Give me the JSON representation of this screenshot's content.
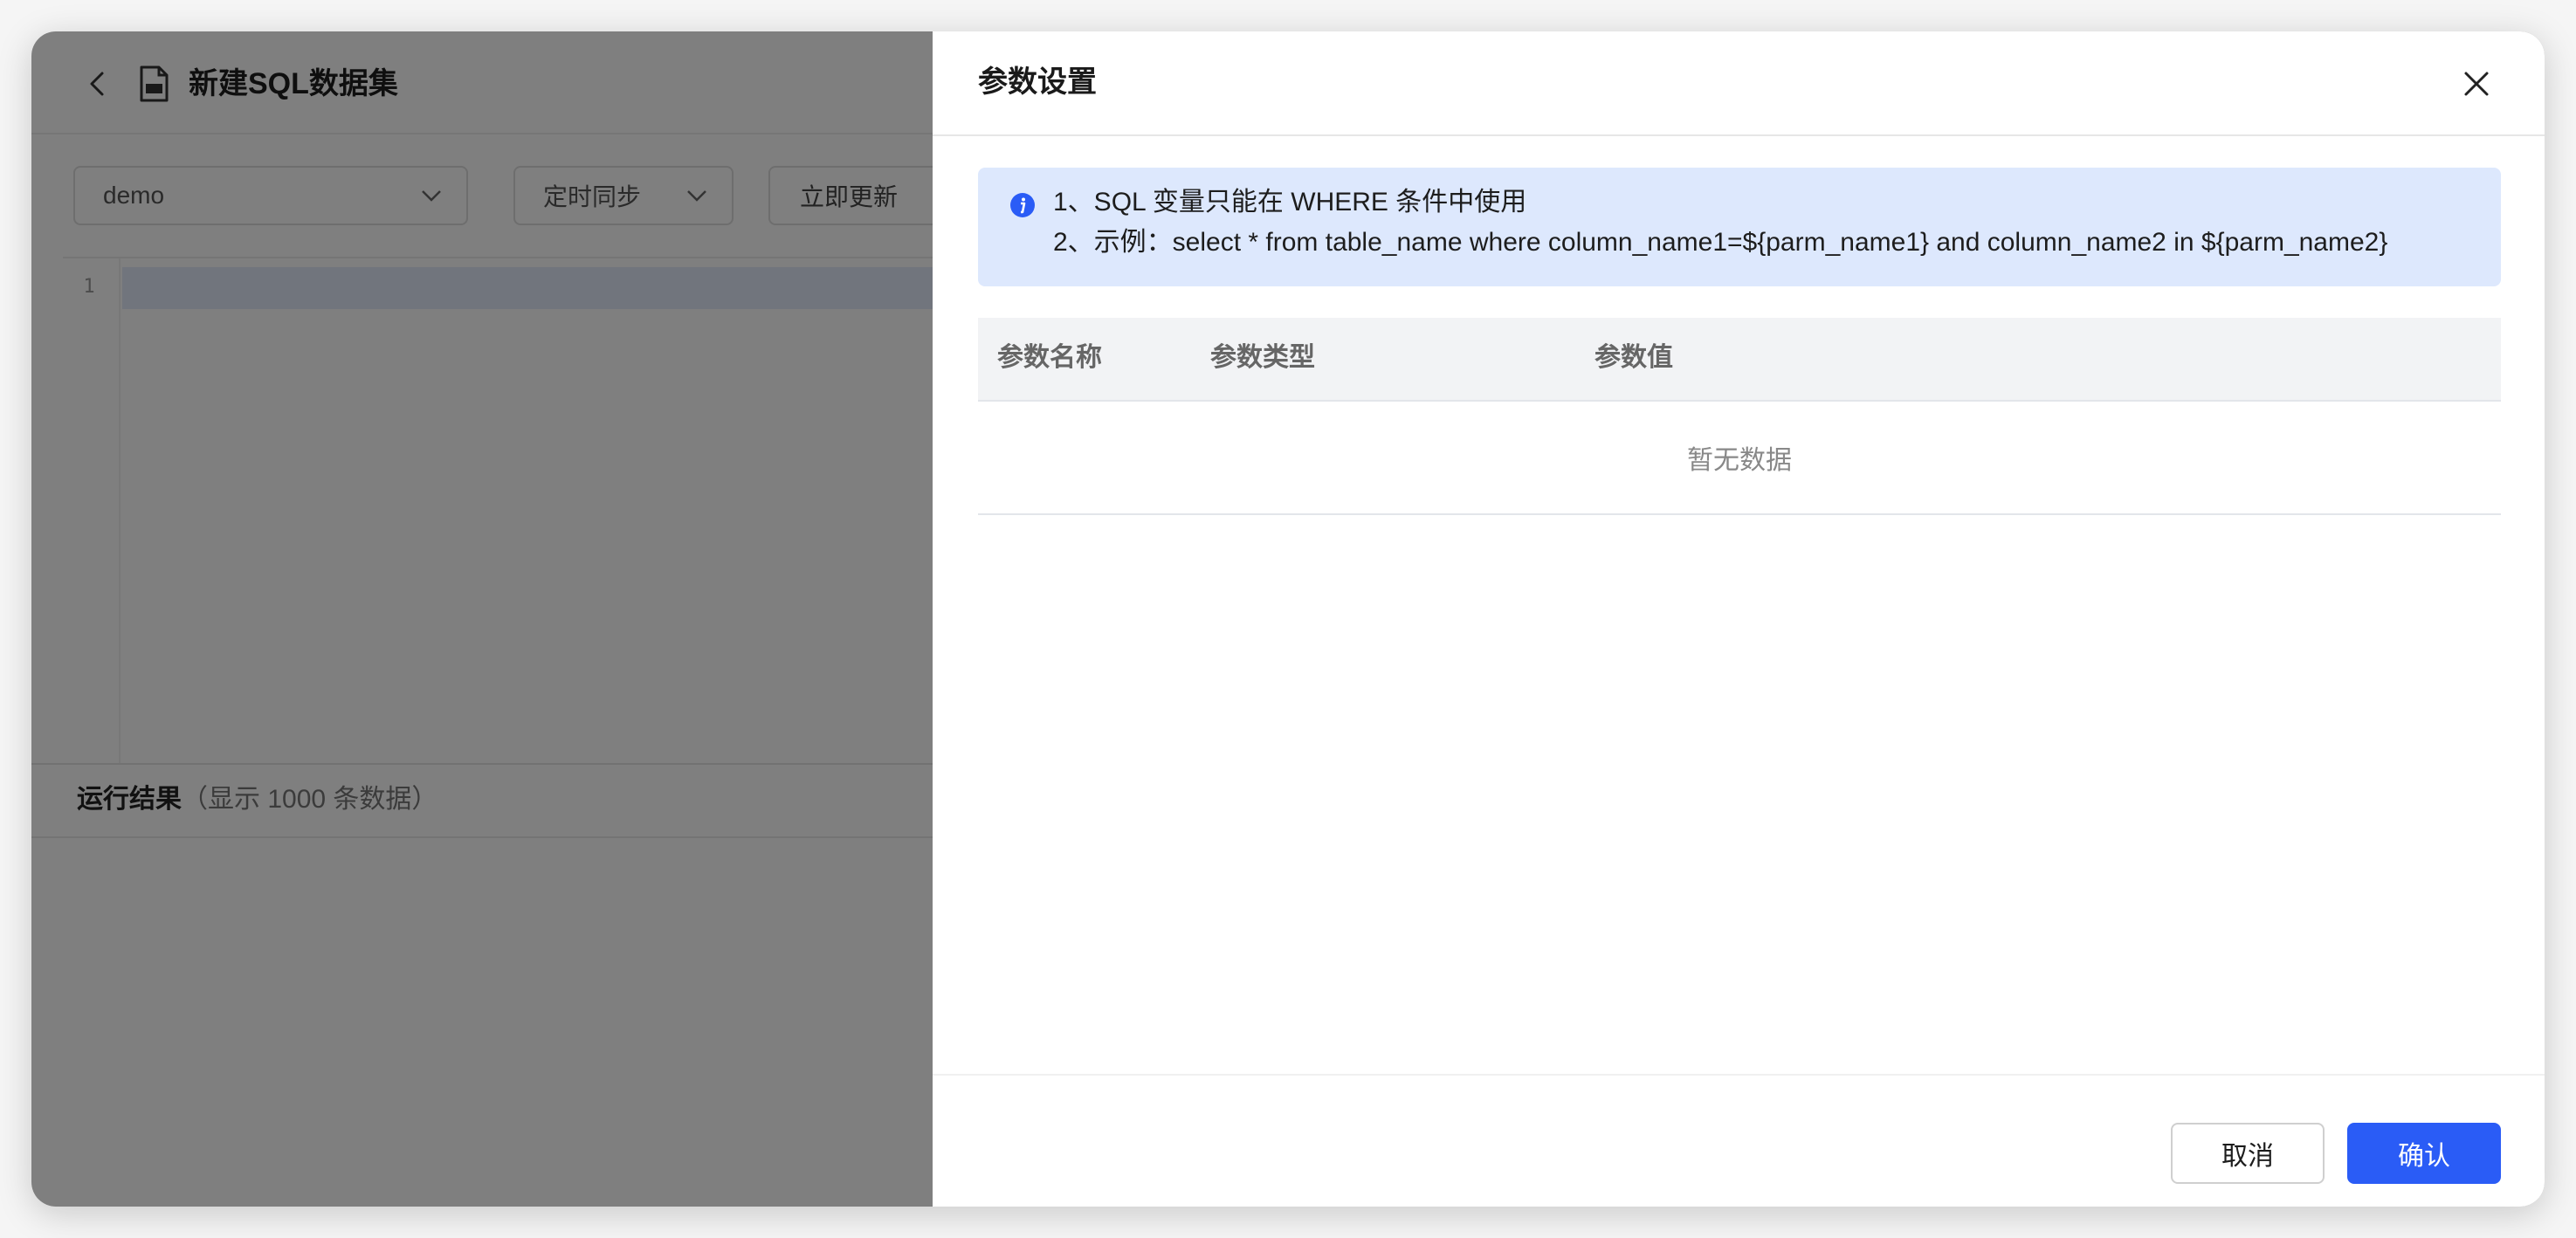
{
  "page": {
    "title": "新建SQL数据集",
    "datasource_select": "demo",
    "sync_mode_select": "定时同步",
    "update_now_label": "立即更新",
    "editor_line_number": "1",
    "result_title": "运行结果",
    "result_subtitle": "（显示 1000 条数据）"
  },
  "drawer": {
    "title": "参数设置",
    "info": {
      "line1": "1、SQL 变量只能在 WHERE 条件中使用",
      "line2": "2、示例：select * from table_name where column_name1=${parm_name1} and column_name2 in ${parm_name2}"
    },
    "table": {
      "headers": [
        "参数名称",
        "参数类型",
        "参数值"
      ],
      "empty_text": "暂无数据"
    },
    "footer": {
      "cancel_label": "取消",
      "confirm_label": "确认"
    }
  },
  "colors": {
    "primary": "#2a5cf6",
    "info_bg": "#dde8fd",
    "overlay": "rgba(0,0,0,0.5)"
  }
}
